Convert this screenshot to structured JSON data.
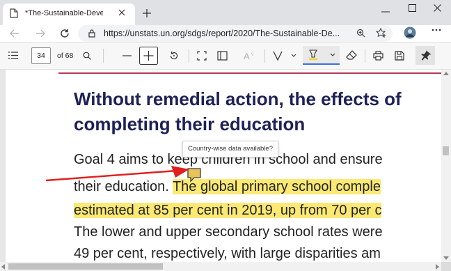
{
  "browser": {
    "tab_title": "*The-Sustainable-Development-",
    "url": "https://unstats.un.org/sdgs/report/2020/The-Sustainable-De..."
  },
  "pdf_toolbar": {
    "page_number": "34",
    "page_count": "of 68"
  },
  "document": {
    "heading_line1": "Without remedial action, the effects of",
    "heading_line2": "completing their education",
    "line1": "Goal 4 aims to keep children in school and ensure",
    "line2_plain": "their education.",
    "line2_highlight": "The global primary school comple",
    "line3_highlight": "estimated at 85 per cent in 2019, up from 70 per c",
    "line4": "The lower and upper secondary school rates were",
    "line5": "49 per cent, respectively, with large disparities am"
  },
  "comment": {
    "tooltip": "Country-wise data available?"
  },
  "colors": {
    "heading": "#1d2157",
    "highlight": "#fbe974",
    "rule": "#b53a58",
    "arrow": "#e0201f"
  }
}
